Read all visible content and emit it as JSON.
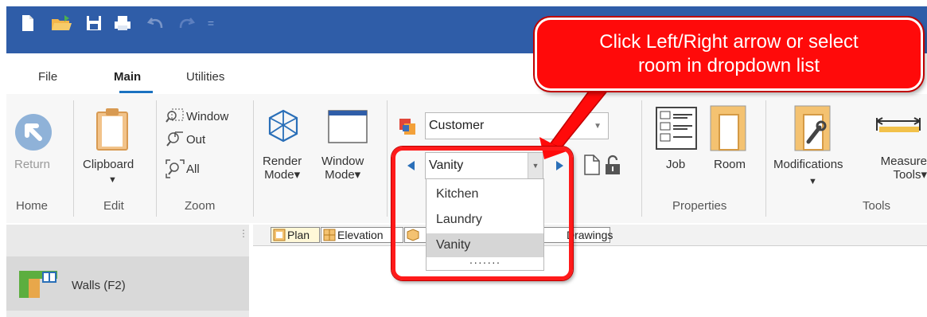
{
  "menu": {
    "tabs": [
      {
        "label": "File"
      },
      {
        "label": "Main"
      },
      {
        "label": "Utilities"
      }
    ]
  },
  "ribbon": {
    "home": {
      "return_label": "Return",
      "group_label": "Home"
    },
    "edit": {
      "clipboard_label": "Clipboard",
      "group_label": "Edit"
    },
    "zoom": {
      "window_label": "Window",
      "out_label": "Out",
      "all_label": "All",
      "group_label": "Zoom"
    },
    "render_mode": {
      "line1": "Render",
      "line2": "Mode▾"
    },
    "window_mode": {
      "line1": "Window",
      "line2": "Mode▾"
    },
    "customer_combo": {
      "value": "Customer"
    },
    "room_combo": {
      "value": "Vanity"
    },
    "properties": {
      "job_label": "Job",
      "room_label": "Room",
      "group_label": "Properties"
    },
    "tools": {
      "modifications_label": "Modifications",
      "measure_line1": "Measure",
      "measure_line2": "Tools▾",
      "group_label": "Tools"
    }
  },
  "dropdown": {
    "items": [
      {
        "label": "Kitchen"
      },
      {
        "label": "Laundry"
      },
      {
        "label": "Vanity"
      }
    ],
    "more": "·······",
    "selected": "Vanity"
  },
  "view_tabs": {
    "plan": "Plan",
    "elevation": "Elevation",
    "drawings": "Drawings"
  },
  "side_panel": {
    "walls_label": "Walls (F2)"
  },
  "callout": {
    "line1": "Click Left/Right arrow or select",
    "line2": "room in dropdown list"
  },
  "colors": {
    "titlebar": "#2f5da8",
    "accent": "#1b72c0",
    "callout": "#ff0a0a"
  }
}
